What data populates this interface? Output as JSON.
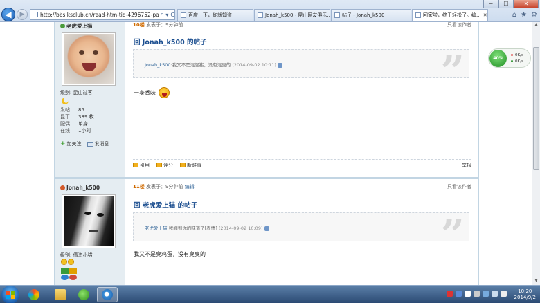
{
  "browser": {
    "url": "http://bbs.ksclub.cn/read-htm-tid-4296752-page-",
    "tabs": [
      {
        "label": "百度一下，你就知道",
        "active": false
      },
      {
        "label": "Jonah_k500 - 昆山网友俱乐...",
        "active": false
      },
      {
        "label": "帖子 - Jonah_k500",
        "active": false
      },
      {
        "label": "回家啦，终于轻松了。编...",
        "active": true
      }
    ],
    "buttons": {
      "minimize": "─",
      "maximize": "☐",
      "close": "✕"
    },
    "tools": {
      "search": "⌕",
      "dropdown": "▾",
      "refresh": "C",
      "home": "⌂",
      "favorites": "★",
      "settings": "⚙"
    }
  },
  "posts": [
    {
      "author": "老虎爱上猫",
      "floor": "10楼",
      "time": "发表于：9分钟前",
      "only_author": "只看该作者",
      "title": "回 Jonah_k500 的帖子",
      "quote_author": "Jonah_k500",
      "quote_text": ":我又不是混混猪，没有混臭的",
      "quote_date": "(2014-09-02 10:11)",
      "body": "一身香味",
      "meta": [
        {
          "k": "级别:",
          "v": "昆山过客"
        },
        {
          "k": "发帖",
          "v": "85"
        },
        {
          "k": "昆币",
          "v": "389 枚"
        },
        {
          "k": "配偶",
          "v": "单身"
        },
        {
          "k": "在线",
          "v": "1小时"
        }
      ],
      "follow": "加关注",
      "message": "发消息",
      "actions": [
        "引用",
        "评分",
        "新鲜事"
      ],
      "report": "举报"
    },
    {
      "author": "Jonah_k500",
      "floor": "11楼",
      "time": "发表于：9分钟前",
      "edit": "编辑",
      "only_author": "只看该作者",
      "title": "回 老虎爱上猫 的帖子",
      "quote_author": "老虎爱上猫",
      "quote_text": ":我闻到你的味道了[表情]",
      "quote_date": "(2014-09-02 10:09)",
      "body": "我又不是臭鸡蛋，没有臭臭的",
      "level": "级别: 倩恣小猫"
    }
  ],
  "widget": {
    "percent": "40%",
    "up": "0K/s",
    "down": "0K/s"
  },
  "taskbar": {
    "time": "10:20",
    "date": "2014/9/2"
  },
  "colors": {
    "accent": "#1a4d8f",
    "side": "#e5edf2",
    "floor": "#cf6a00"
  }
}
